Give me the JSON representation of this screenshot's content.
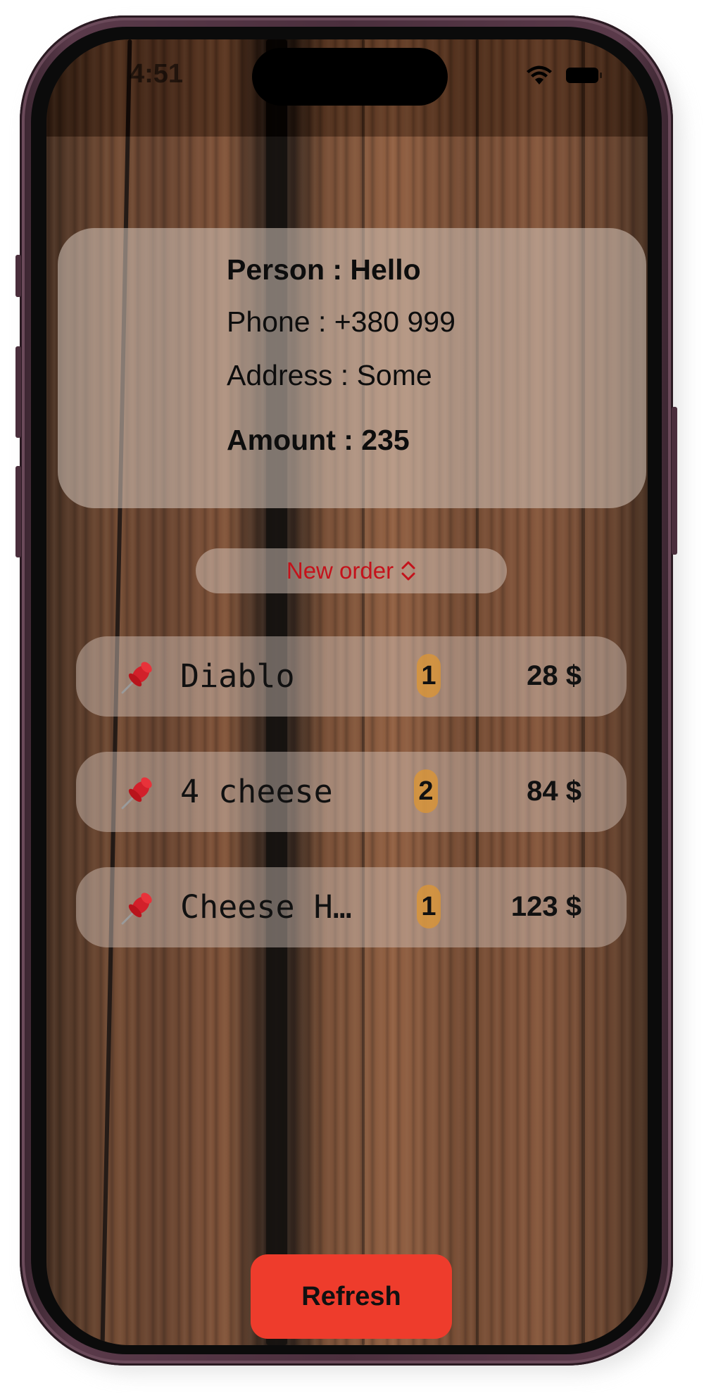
{
  "status_bar": {
    "time": "4:51",
    "icons": [
      "wifi-icon",
      "battery-icon"
    ]
  },
  "customer": {
    "person": "Person : Hello",
    "phone": "Phone : +380 999",
    "address": "Address : Some",
    "amount": "Amount : 235"
  },
  "picker": {
    "label": "New order",
    "color": "#c4121b",
    "icon": "chevron-updown-icon"
  },
  "orders": [
    {
      "name": "Diablo",
      "quantity": "1",
      "price": "28 $",
      "icon": "pushpin-icon"
    },
    {
      "name": "4 cheese",
      "quantity": "2",
      "price": "84 $",
      "icon": "pushpin-icon"
    },
    {
      "name": "Cheese H…",
      "quantity": "1",
      "price": "123 $",
      "icon": "pushpin-icon"
    }
  ],
  "refresh": {
    "label": "Refresh",
    "color": "#ee3c2c"
  },
  "colors": {
    "badge": "#de9632",
    "frame": "#4b2f3d"
  }
}
